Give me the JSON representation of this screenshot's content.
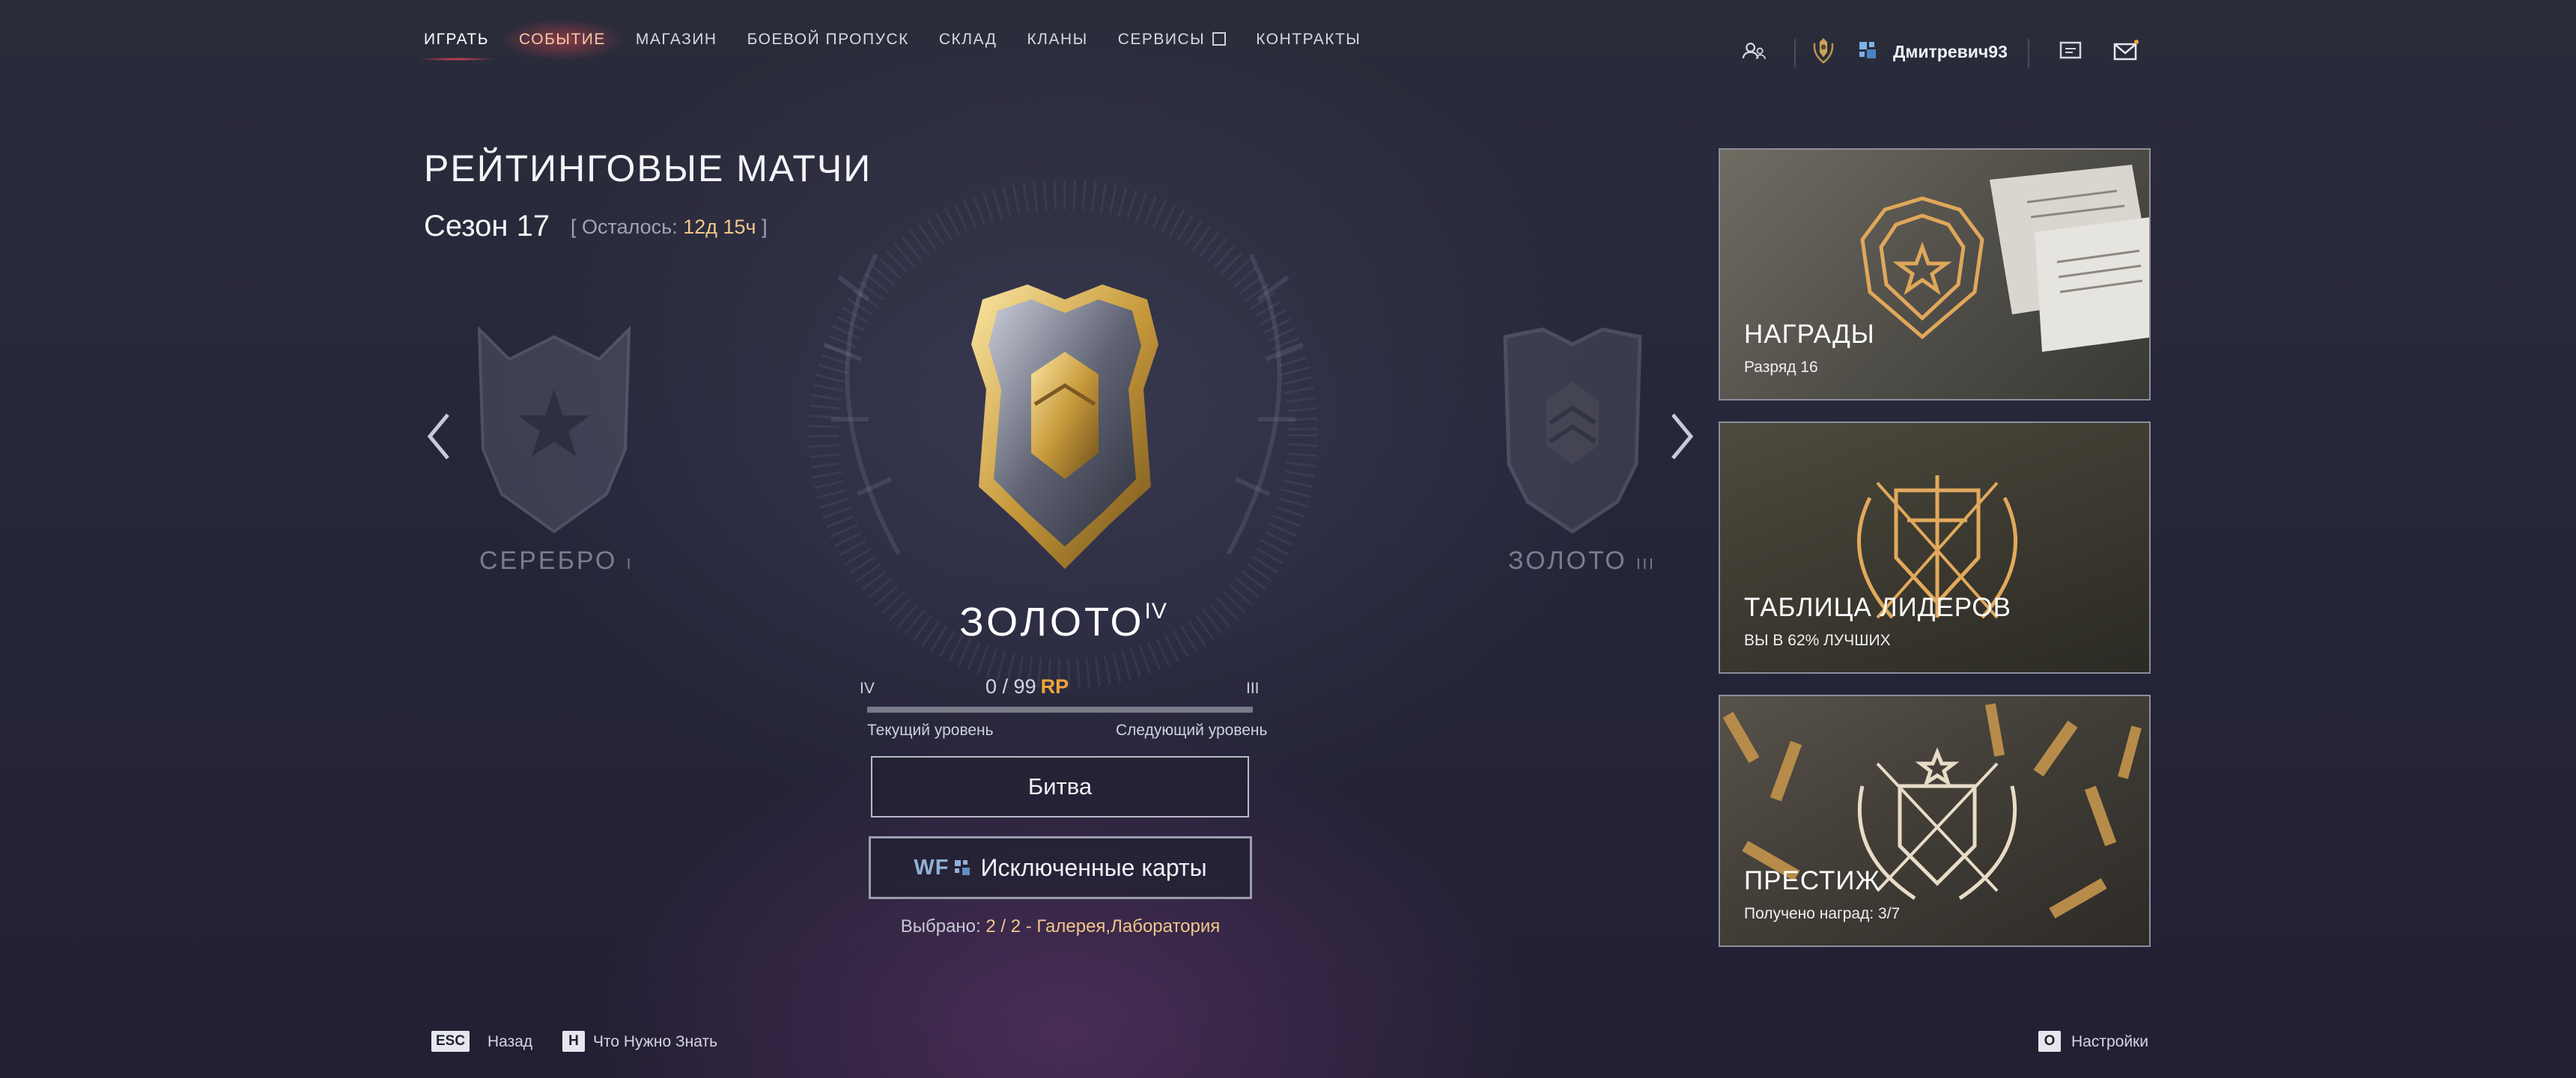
{
  "nav": {
    "items": [
      {
        "label": "ИГРАТЬ"
      },
      {
        "label": "СОБЫТИЕ"
      },
      {
        "label": "МАГАЗИН"
      },
      {
        "label": "БОЕВОЙ ПРОПУСК"
      },
      {
        "label": "СКЛАД"
      },
      {
        "label": "КЛАНЫ"
      },
      {
        "label": "СЕРВИСЫ"
      },
      {
        "label": "КОНТРАКТЫ"
      }
    ]
  },
  "user": {
    "name": "Дмитревич93"
  },
  "page": {
    "title": "РЕЙТИНГОВЫЕ МАТЧИ",
    "season": "Сезон 17",
    "remaining_prefix": "[ Осталось: ",
    "remaining_value": "12д 15ч",
    "remaining_suffix": " ]"
  },
  "ranks": {
    "prev": {
      "name": "СЕРЕБРО",
      "tier": "I"
    },
    "current": {
      "name": "ЗОЛОТО",
      "tier": "IV"
    },
    "next": {
      "name": "ЗОЛОТО",
      "tier": "III"
    }
  },
  "progress": {
    "current_level": "IV",
    "next_level": "III",
    "rp_current": "0",
    "rp_sep": " / ",
    "rp_total": "99",
    "rp_unit": "RP",
    "fraction": 0,
    "current_caption": "Текущий уровень",
    "next_caption": "Следующий уровень"
  },
  "buttons": {
    "battle": "Битва",
    "excluded_maps": "Исключенные карты",
    "wf_logo": "WF"
  },
  "selection": {
    "prefix": "Выбрано: ",
    "value": "2 / 2 - Галерея,Лаборатория"
  },
  "cards": [
    {
      "title": "НАГРАДЫ",
      "subtitle": "Разряд 16"
    },
    {
      "title": "ТАБЛИЦА ЛИДЕРОВ",
      "subtitle": "ВЫ В 62% ЛУЧШИХ"
    },
    {
      "title": "ПРЕСТИЖ",
      "subtitle": "Получено наград: 3/7"
    }
  ],
  "bottom": {
    "esc_key": "ESC",
    "back_label": "Назад",
    "h_key": "H",
    "info_label": "Что Нужно Знать",
    "settings_key": "O",
    "settings_label": "Настройки"
  },
  "colors": {
    "accent_gold": "#f0a63a",
    "highlight": "#f2c68a",
    "nav_active_underline": "#e8465a"
  },
  "icons": [
    "friends-icon",
    "rank-emblem-icon",
    "clan-icon",
    "chat-icon",
    "mail-icon",
    "chevron-left-icon",
    "chevron-right-icon",
    "external-link-icon"
  ]
}
